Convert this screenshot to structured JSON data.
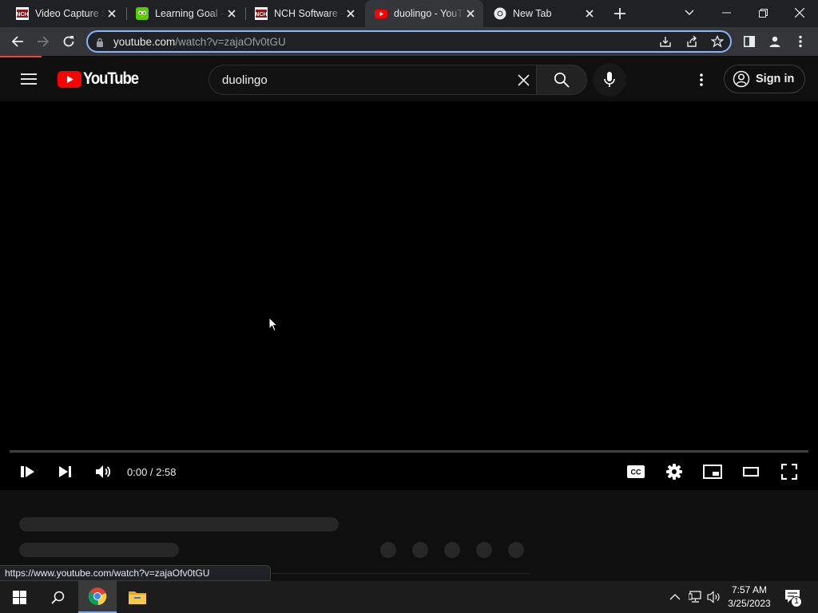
{
  "browser": {
    "tabs": [
      {
        "title": "Video Capture S",
        "icon": "nch-icon"
      },
      {
        "title": "Learning Goal -",
        "icon": "duolingo-icon"
      },
      {
        "title": "NCH Software -",
        "icon": "nch-icon"
      },
      {
        "title": "duolingo - YouT",
        "icon": "youtube-icon",
        "active": true
      },
      {
        "title": "New Tab",
        "icon": "chrome-icon"
      }
    ],
    "url_domain": "youtube.com",
    "url_path": "/watch?v=zajaOfv0tGU",
    "status_url": "https://www.youtube.com/watch?v=zajaOfv0tGU"
  },
  "youtube": {
    "logo_text": "YouTube",
    "search_value": "duolingo",
    "signin_label": "Sign in"
  },
  "player": {
    "time": "0:00 / 2:58",
    "progress": 0
  },
  "taskbar": {
    "time": "7:57 AM",
    "date": "3/25/2023",
    "notification_count": "1"
  },
  "colors": {
    "youtube_red": "#ff0000",
    "omnibox_focus": "#8ab4f8"
  }
}
